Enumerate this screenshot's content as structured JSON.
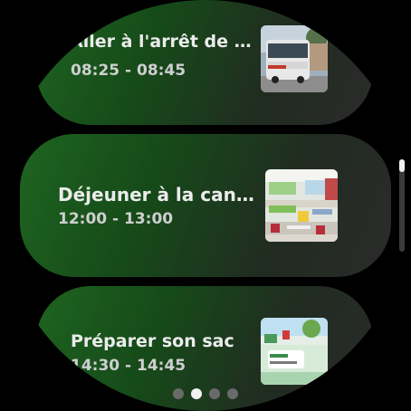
{
  "activities": [
    {
      "title": "Aller à l'arrêt de b…",
      "time": "08:25 - 08:45",
      "image_icon": "bus-photo"
    },
    {
      "title": "Déjeuner à la cant…",
      "time": "12:00 - 13:00",
      "image_icon": "canteen-photo"
    },
    {
      "title": "Préparer son sac",
      "time": "14:30 - 14:45",
      "image_icon": "school-bag-card-photo"
    }
  ],
  "pager": {
    "page_count": 4,
    "current_page": 2
  },
  "scroll": {
    "position": 0.0
  },
  "colors": {
    "card_start": "#1e6420",
    "card_end": "#2b2b2b",
    "text": "#ececec",
    "dot_active": "#f2f2f2",
    "dot_inactive": "#6a6a6a"
  }
}
